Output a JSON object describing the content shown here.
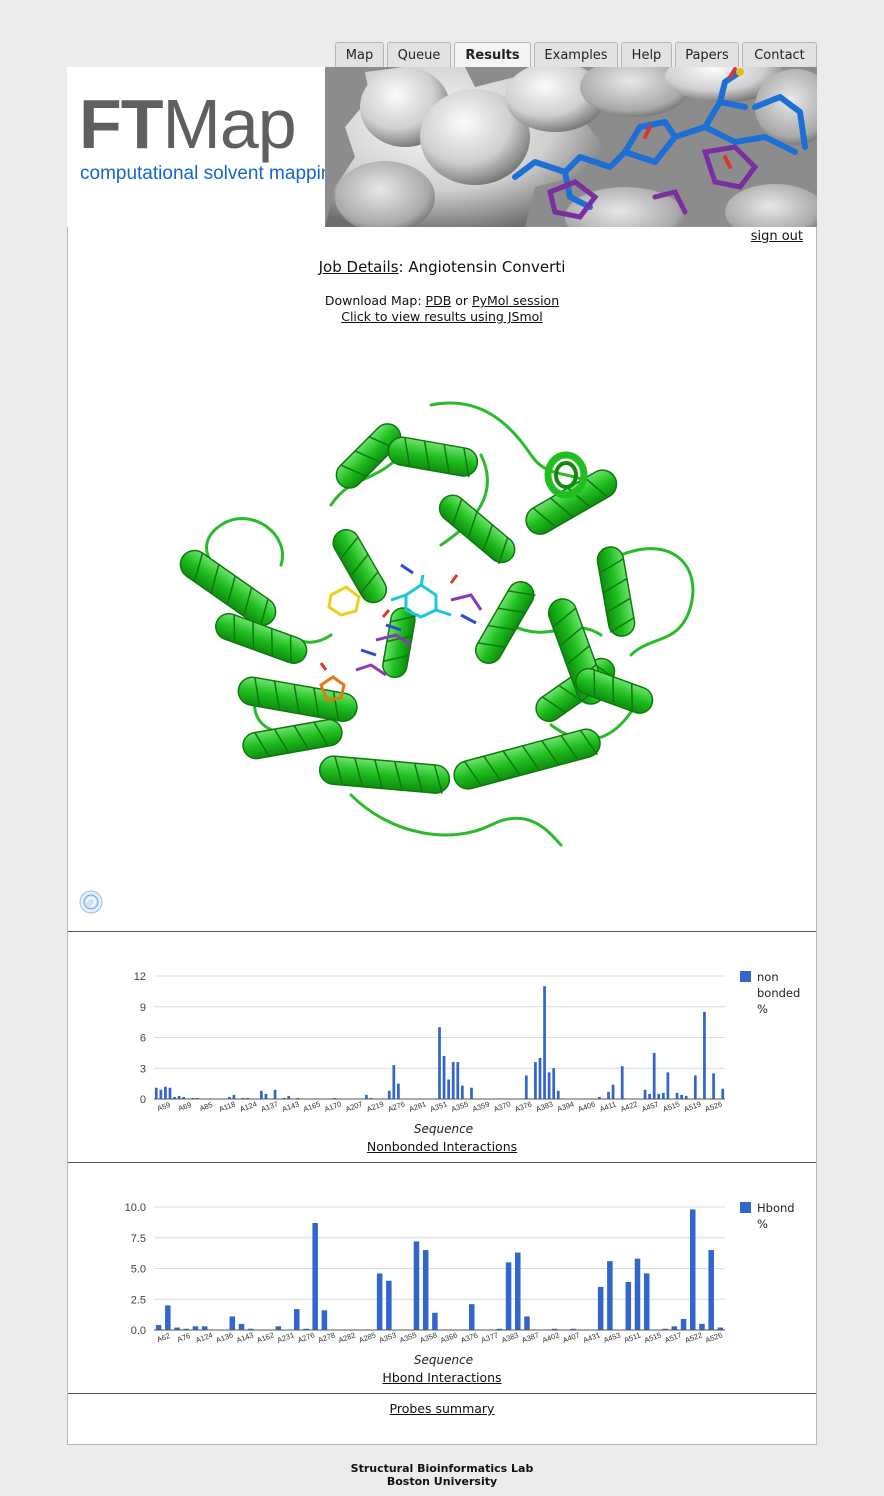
{
  "tabs": [
    {
      "label": "Map",
      "active": false
    },
    {
      "label": "Queue",
      "active": false
    },
    {
      "label": "Results",
      "active": true
    },
    {
      "label": "Examples",
      "active": false
    },
    {
      "label": "Help",
      "active": false
    },
    {
      "label": "Papers",
      "active": false
    },
    {
      "label": "Contact",
      "active": false
    }
  ],
  "header": {
    "logo_bold": "FT",
    "logo_rest": "Map",
    "subtitle": "computational solvent mapping"
  },
  "signout": "sign out",
  "job": {
    "label": "Job Details",
    "separator": ":",
    "name": "Angiotensin Converti"
  },
  "download": {
    "prefix": "Download Map:",
    "pdb": "PDB",
    "or": "or",
    "pymol": "PyMol session",
    "jsmol": "Click to view results using JSmol"
  },
  "icons": {
    "refresh": "refresh-icon"
  },
  "colors": {
    "bar": "#3366cc",
    "protein": "#22bb22",
    "logo_blue": "#1466c9"
  },
  "chart_data": [
    {
      "type": "bar",
      "xlabel": "Sequence",
      "ylabel": "",
      "ylim": [
        0,
        12
      ],
      "yticks": [
        "0",
        "3",
        "6",
        "9",
        "12"
      ],
      "legend": [
        "non",
        "bonded",
        "%"
      ],
      "legend_position": "right",
      "tick_labels": [
        "A59",
        "A69",
        "A85",
        "A118",
        "A124",
        "A137",
        "A143",
        "A165",
        "A170",
        "A207",
        "A219",
        "A276",
        "A281",
        "A351",
        "A355",
        "A359",
        "A370",
        "A376",
        "A383",
        "A394",
        "A406",
        "A411",
        "A422",
        "A457",
        "A515",
        "A519",
        "A526"
      ],
      "values": [
        1.1,
        0.9,
        1.2,
        1.1,
        0.2,
        0.3,
        0.2,
        0,
        0.1,
        0.1,
        0,
        0,
        0,
        0,
        0,
        0,
        0.2,
        0.4,
        0,
        0.1,
        0.1,
        0,
        0,
        0.8,
        0.5,
        0,
        0.9,
        0,
        0.1,
        0.3,
        0,
        0.1,
        0,
        0,
        0,
        0,
        0,
        0,
        0,
        0.1,
        0,
        0,
        0,
        0,
        0,
        0,
        0.4,
        0.1,
        0,
        0,
        0,
        0.8,
        3.3,
        1.5,
        0,
        0,
        0,
        0,
        0,
        0,
        0,
        0,
        7,
        4.2,
        1.9,
        3.6,
        3.6,
        1.3,
        0,
        1.1,
        0,
        0,
        0,
        0,
        0,
        0,
        0,
        0,
        0,
        0,
        0,
        2.3,
        0,
        3.6,
        4,
        11,
        2.6,
        3,
        0.8,
        0,
        0,
        0,
        0,
        0,
        0,
        0,
        0,
        0.2,
        0,
        0.7,
        1.4,
        0,
        3.2,
        0,
        0,
        0,
        0,
        0.9,
        0.5,
        4.5,
        0.5,
        0.6,
        2.6,
        0,
        0.6,
        0.4,
        0.3,
        0,
        2.3,
        0,
        8.5,
        0,
        2.5,
        0,
        1
      ],
      "link": "Nonbonded Interactions"
    },
    {
      "type": "bar",
      "xlabel": "Sequence",
      "ylabel": "",
      "ylim": [
        0,
        10
      ],
      "yticks": [
        "0.0",
        "2.5",
        "5.0",
        "7.5",
        "10.0"
      ],
      "legend": [
        "Hbond",
        "%"
      ],
      "legend_position": "right",
      "tick_labels": [
        "A62",
        "A76",
        "A124",
        "A136",
        "A143",
        "A162",
        "A231",
        "A276",
        "A278",
        "A282",
        "A285",
        "A353",
        "A355",
        "A358",
        "A366",
        "A376",
        "A377",
        "A383",
        "A387",
        "A402",
        "A407",
        "A431",
        "A453",
        "A511",
        "A515",
        "A517",
        "A522",
        "A526"
      ],
      "values": [
        0.4,
        2,
        0.2,
        0.1,
        0.3,
        0.3,
        0,
        0,
        1.1,
        0.5,
        0.1,
        0,
        0,
        0.3,
        0,
        1.7,
        0.1,
        8.7,
        1.6,
        0,
        0,
        0,
        0,
        0,
        4.6,
        4,
        0,
        0,
        7.2,
        6.5,
        1.4,
        0,
        0,
        0,
        2.1,
        0,
        0,
        0.1,
        5.5,
        6.3,
        1.1,
        0,
        0,
        0.1,
        0,
        0.1,
        0,
        0,
        3.5,
        5.6,
        0,
        3.9,
        5.8,
        4.6,
        0,
        0.1,
        0.3,
        0.9,
        9.8,
        0.5,
        6.5,
        0.2
      ],
      "link": "Hbond Interactions"
    }
  ],
  "probes_summary": "Probes summary",
  "footer": {
    "line1": "Structural Bioinformatics Lab",
    "line2": "Boston University"
  }
}
